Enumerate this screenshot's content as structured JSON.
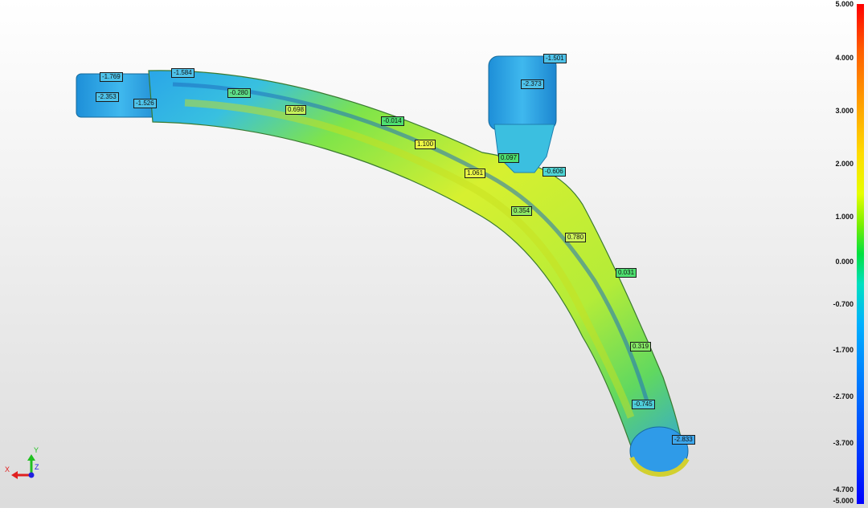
{
  "color_scale": {
    "ticks": [
      "5.000",
      "4.000",
      "3.000",
      "2.000",
      "1.000",
      "0.000",
      "-0.700",
      "-1.700",
      "-2.700",
      "-3.700",
      "-4.700",
      "-5.000"
    ]
  },
  "annotations": [
    {
      "text": "-1.769",
      "color": "#4fc3ea"
    },
    {
      "text": "-1.584",
      "color": "#4fc3ea"
    },
    {
      "text": "-2.353",
      "color": "#4fc3ea"
    },
    {
      "text": "-1.526",
      "color": "#4fc3ea"
    },
    {
      "text": "-0.280",
      "color": "#5ee08a"
    },
    {
      "text": "0.698",
      "color": "#c8f25c"
    },
    {
      "text": "-0.014",
      "color": "#4ee070"
    },
    {
      "text": "1.100",
      "color": "#ecf745"
    },
    {
      "text": "0.097",
      "color": "#4ee070"
    },
    {
      "text": "1.061",
      "color": "#e9f547"
    },
    {
      "text": "-0.606",
      "color": "#4fd6d6"
    },
    {
      "text": "0.354",
      "color": "#8ee864"
    },
    {
      "text": "0.780",
      "color": "#cdf25a"
    },
    {
      "text": "0.031",
      "color": "#4ee070"
    },
    {
      "text": "0.319",
      "color": "#86e866"
    },
    {
      "text": "-0.745",
      "color": "#4fcdd8"
    },
    {
      "text": "-2.833",
      "color": "#3ea8ee"
    },
    {
      "text": "-1.501",
      "color": "#4fc3ea"
    },
    {
      "text": "-2.373",
      "color": "#4fc3ea"
    }
  ],
  "axes": {
    "x": "X",
    "y": "Y",
    "z": "Z",
    "x_color": "#e02020",
    "y_color": "#20c020",
    "z_color": "#2020e0"
  }
}
